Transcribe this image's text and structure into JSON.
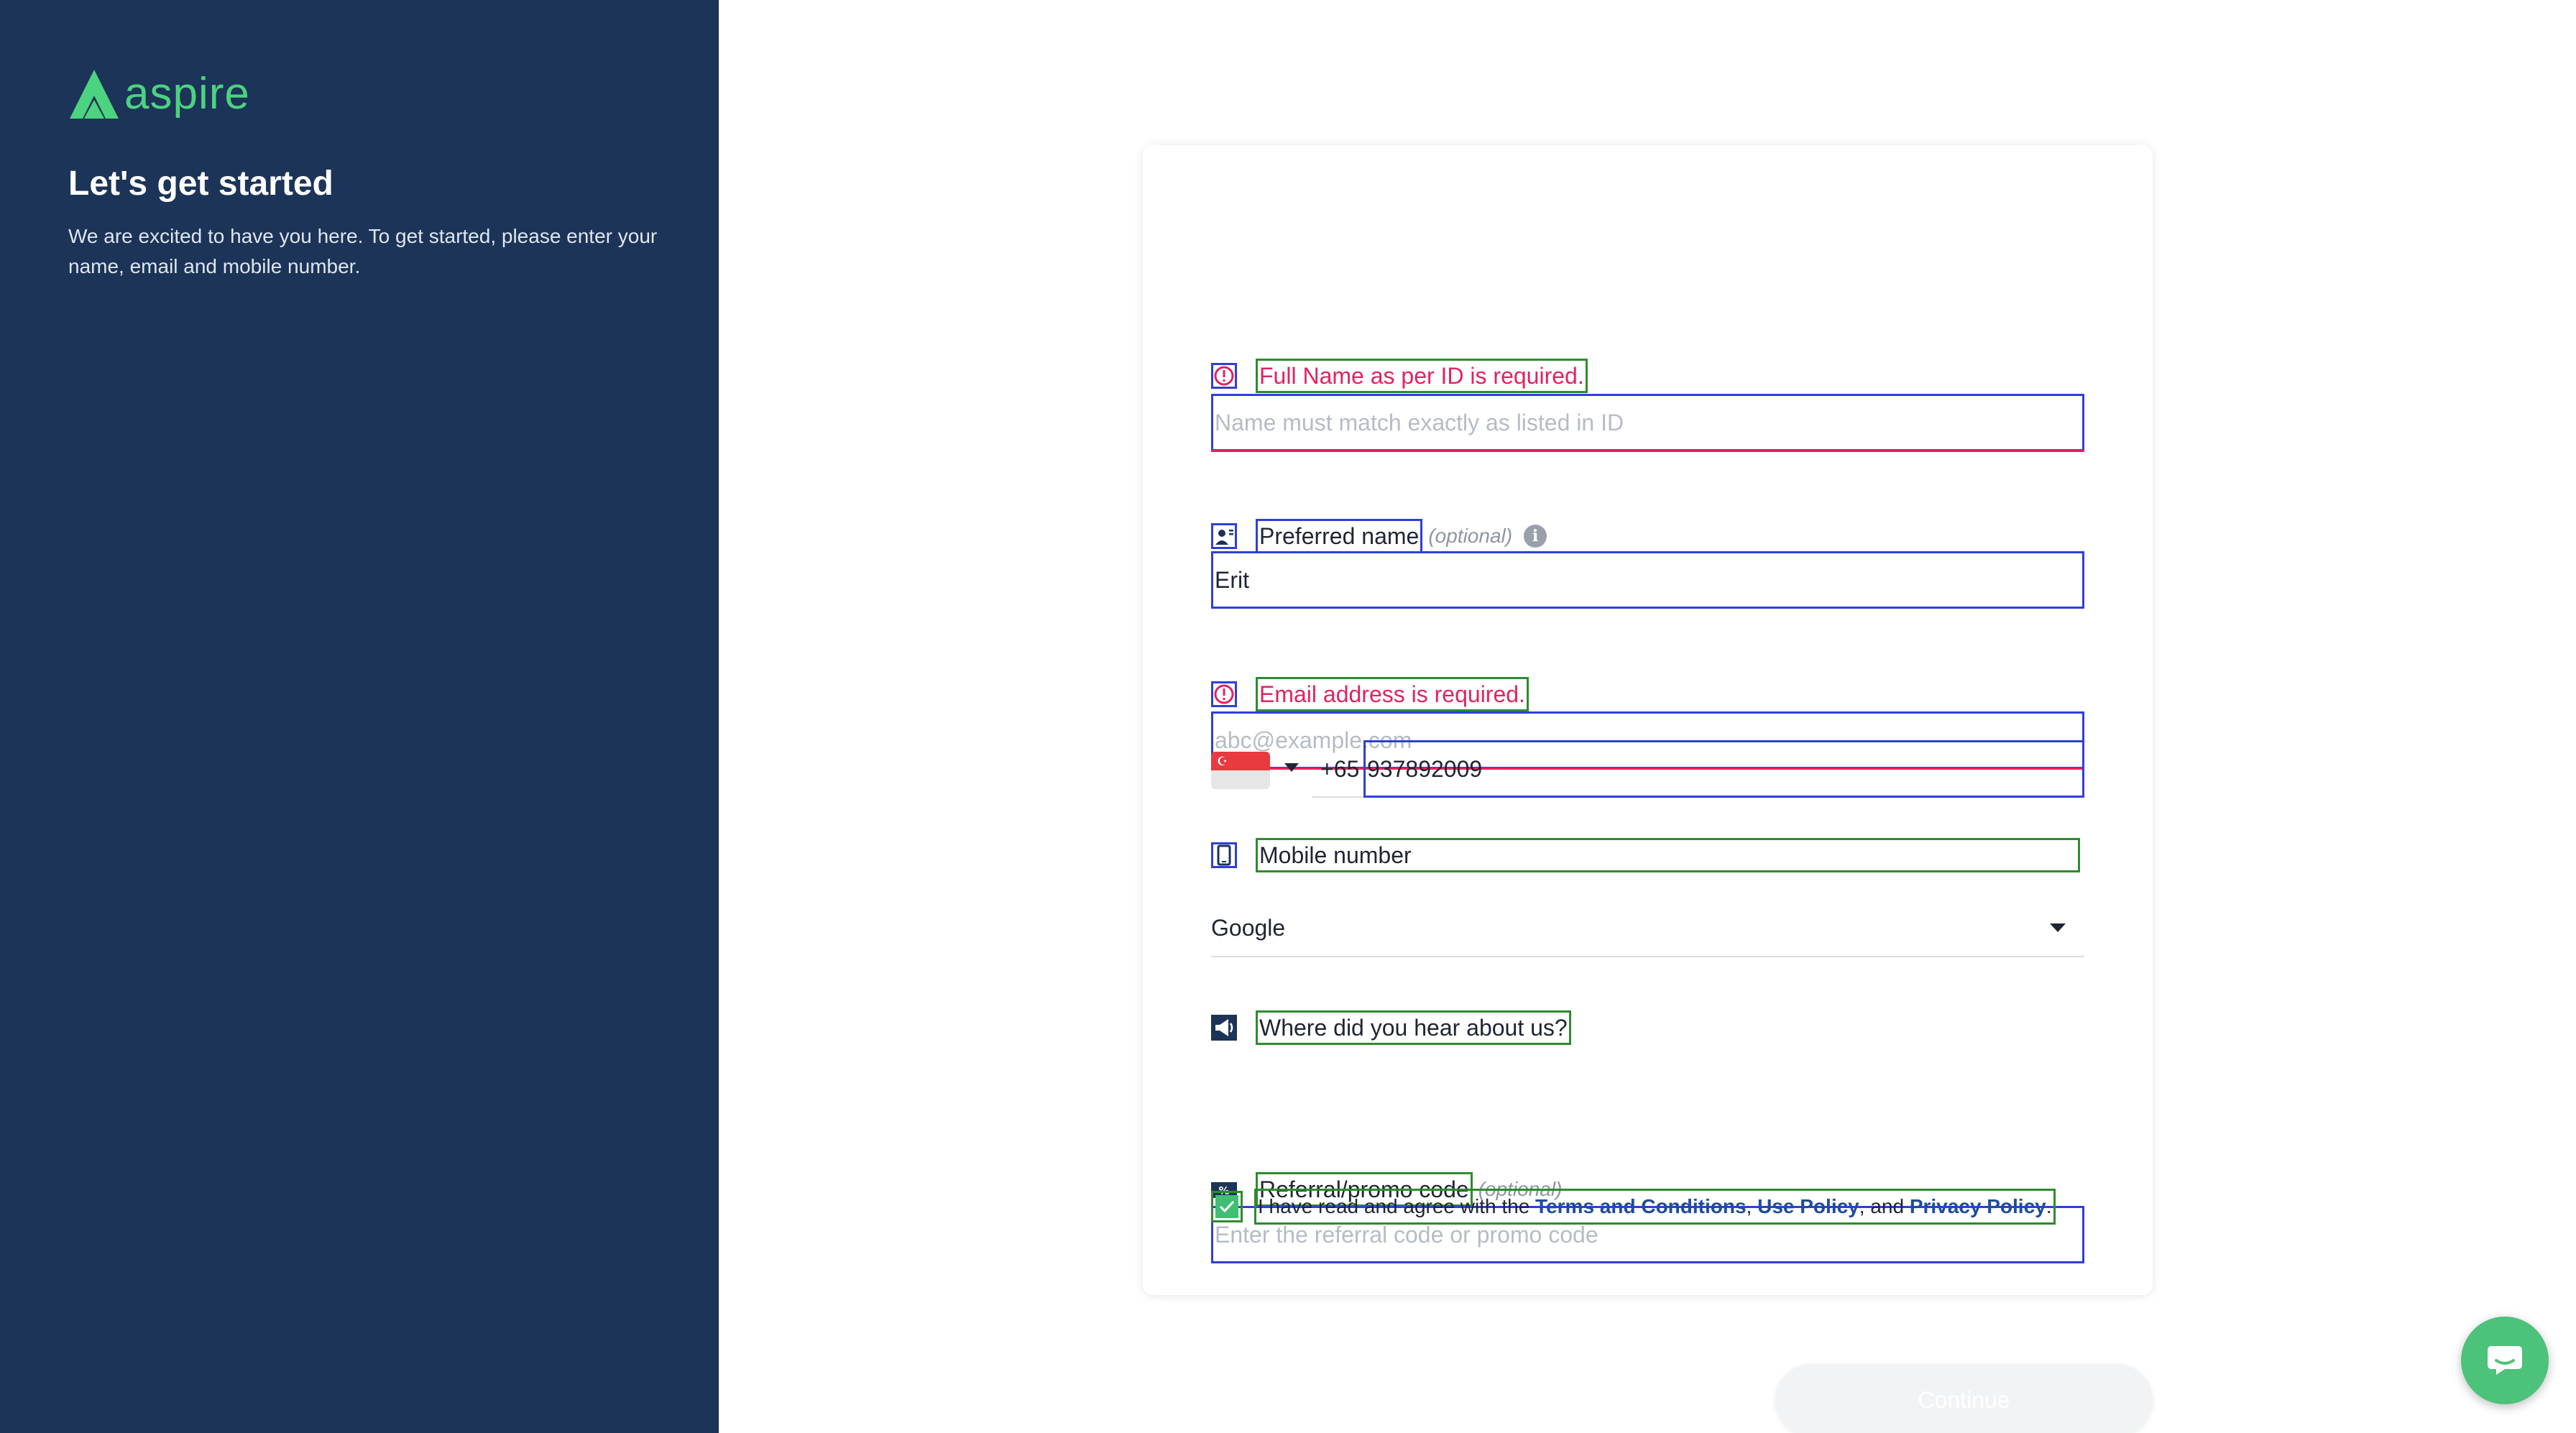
{
  "brand": {
    "name": "aspire"
  },
  "intro": {
    "title": "Let's get started",
    "text": "We are excited to have you here. To get started, please enter your name, email and mobile number."
  },
  "form": {
    "full_name": {
      "label": "Full Name as per ID is required.",
      "placeholder": "Name must match exactly as listed in ID",
      "value": ""
    },
    "preferred_name": {
      "label": "Preferred name",
      "optional": "(optional)",
      "value": "Erit"
    },
    "email": {
      "label": "Email address is required.",
      "placeholder": "abc@example.com",
      "value": ""
    },
    "mobile": {
      "label": "Mobile number",
      "dial_code": "+65",
      "value": "937892009"
    },
    "source": {
      "label": "Where did you hear about us?",
      "value": "Google"
    },
    "referral": {
      "label": "Referral/promo code",
      "optional": "(optional)",
      "placeholder": "Enter the referral code or promo code",
      "value": ""
    },
    "consent": {
      "prefix": "I have read and agree with the ",
      "terms": "Terms and Conditions",
      "sep1": ", ",
      "use_policy": "Use Policy",
      "sep2": ", and ",
      "privacy": "Privacy Policy",
      "suffix": ".",
      "checked": true
    }
  },
  "actions": {
    "continue_label": "Continue"
  },
  "colors": {
    "sidebar": "#1b3458",
    "brand_green": "#4cd37f",
    "error": "#e0245e",
    "link": "#1f4c9c",
    "check_green": "#3fbf74"
  },
  "icons": {
    "logo": "aspire-logo-icon",
    "full_name": "alert-circle-icon",
    "preferred_name": "id-card-icon",
    "email": "alert-circle-icon",
    "mobile": "mobile-phone-icon",
    "source": "megaphone-icon",
    "referral": "percent-tag-icon",
    "info": "info-icon",
    "chat": "chat-bubble-icon"
  }
}
